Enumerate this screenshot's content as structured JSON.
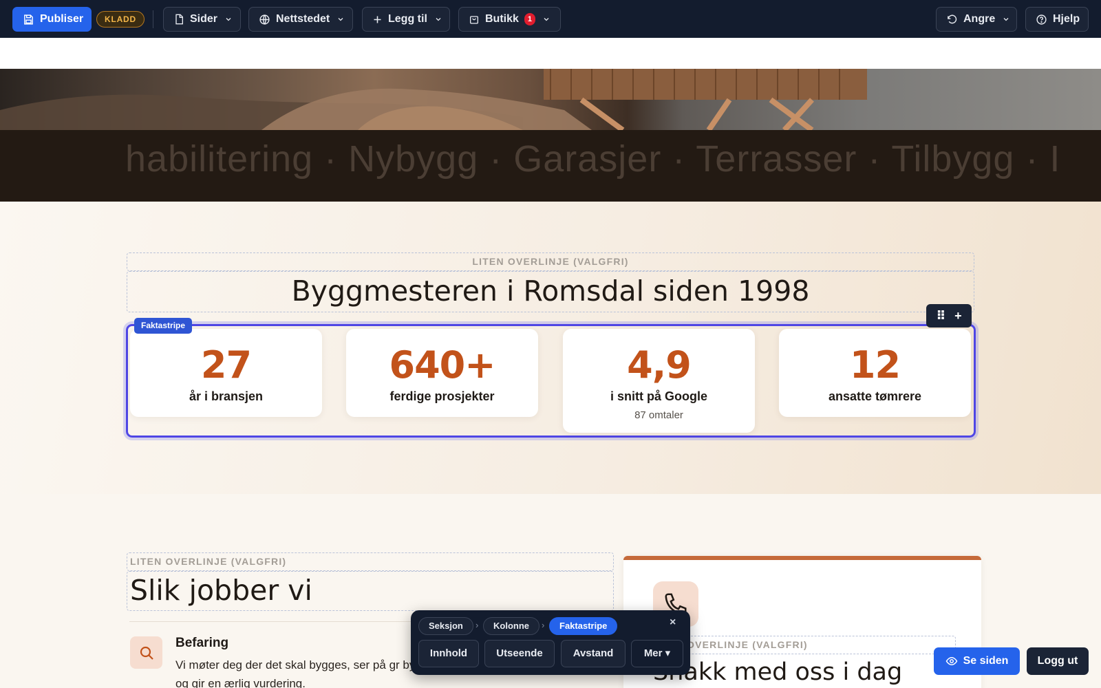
{
  "toolbar": {
    "publish_label": "Publiser",
    "draft_badge": "KLADD",
    "pages_label": "Sider",
    "site_label": "Nettstedet",
    "add_label": "Legg til",
    "shop_label": "Butikk",
    "shop_count": "1",
    "undo_label": "Angre",
    "help_label": "Hjelp"
  },
  "ticker": {
    "text": "habilitering · Nybygg · Garasjer · Terrasser  ·  Tilbygg · I"
  },
  "facts_section": {
    "overline_placeholder": "LITEN OVERLINJE (VALGFRI)",
    "title": "Byggmesteren i Romsdal siden 1998",
    "block_tag": "Faktastripe",
    "tools": {
      "drag_symbol": "⠿",
      "add_symbol": "+"
    },
    "facts": [
      {
        "value": "27",
        "label": "år i bransjen"
      },
      {
        "value": "640+",
        "label": "ferdige prosjekter"
      },
      {
        "value": "4,9",
        "label": "i snitt på Google",
        "sublabel": "87 omtaler"
      },
      {
        "value": "12",
        "label": "ansatte tømrere"
      }
    ]
  },
  "work_section": {
    "overline_placeholder": "LITEN OVERLINJE (VALGFRI)",
    "title": "Slik jobber vi",
    "step": {
      "title": "Befaring",
      "description": "Vi møter deg der det skal bygges, ser på gr bygg og gir en ærlig vurdering."
    }
  },
  "contact_card": {
    "overline_placeholder": "OVERLINJE (VALGFRI)",
    "title": "Snakk med oss i dag"
  },
  "editor_panel": {
    "breadcrumb": [
      "Seksjon",
      "Kolonne",
      "Faktastripe"
    ],
    "close_symbol": "×",
    "actions": {
      "content": "Innhold",
      "appearance": "Utseende",
      "spacing": "Avstand",
      "more": "Mer ▾"
    }
  },
  "bottom": {
    "view_label": "Se siden",
    "logout_label": "Logg ut"
  },
  "colors": {
    "toolbar_bg": "#131c2e",
    "primary": "#2563eb",
    "accent_number": "#c2521a",
    "selection_frame": "#4f46e5",
    "draft_badge": "#f4b649"
  }
}
